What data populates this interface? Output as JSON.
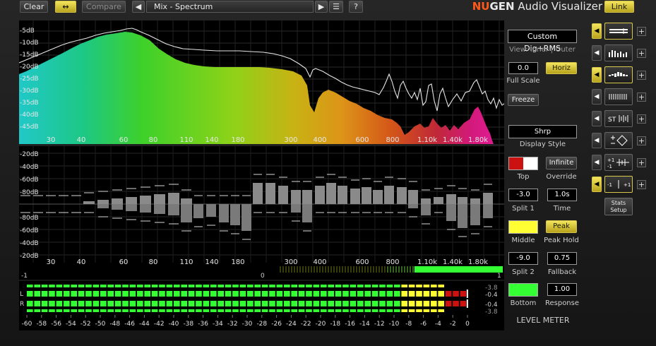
{
  "toolbar": {
    "clear_label": "Clear",
    "swap_glyph": "↔",
    "compare_label": "Compare",
    "preset_name": "Mix - Spectrum",
    "help_label": "?"
  },
  "brand": {
    "prefix": "NU",
    "mid": "GEN",
    "suffix": " Audio Visualizer",
    "link_label": "Link"
  },
  "colors": {
    "accent_yellow": "#e8d83a",
    "top_red": "#cc1111",
    "middle_yellow": "#ffff33",
    "bottom_green": "#33ff33"
  },
  "spectrum": {
    "db_labels": [
      "-5dB",
      "-10dB",
      "-15dB",
      "-20dB",
      "-25dB",
      "-30dB",
      "-35dB",
      "-40dB",
      "-45dB"
    ],
    "freq_labels": [
      "30",
      "40",
      "60",
      "80",
      "110",
      "140",
      "180",
      "300",
      "400",
      "600",
      "800",
      "1.10k",
      "1.40k",
      "1.80k"
    ]
  },
  "stats": {
    "db_labels": [
      "-20dB",
      "-40dB",
      "-60dB",
      "-80dB",
      "-80dB",
      "-60dB",
      "-40dB",
      "-20dB"
    ],
    "freq_labels": [
      "30",
      "40",
      "60",
      "80",
      "110",
      "140",
      "180",
      "300",
      "400",
      "600",
      "800",
      "1.10k",
      "1.40k",
      "1.80k"
    ]
  },
  "correlation": {
    "left_label": "-1",
    "center_label": "0",
    "right_label": "1",
    "value": 0.78
  },
  "level_meter": {
    "title": "LEVEL METER",
    "channel_L": "L",
    "channel_R": "R",
    "peak_values": [
      "-3.8",
      "-0.4",
      "-0.4",
      "-3.8"
    ],
    "scale": [
      "-60",
      "-58",
      "-56",
      "-54",
      "-52",
      "-50",
      "-48",
      "-46",
      "-44",
      "-42",
      "-40",
      "-38",
      "-36",
      "-34",
      "-32",
      "-30",
      "-28",
      "-26",
      "-24",
      "-22",
      "-20",
      "-18",
      "-16",
      "-14",
      "-12",
      "-10",
      "-8",
      "-6",
      "-4",
      "-2",
      "0"
    ],
    "l_level_db": -3.8,
    "r_level_db": -3.8,
    "peak_hold_db": -0.4
  },
  "controls": {
    "display_mode": "Custom Dig+RMS",
    "view_text": "View: Inner | Outer",
    "full_scale_value": "0.0",
    "full_scale_label": "Full Scale",
    "horiz_label": "Horiz",
    "freeze_label": "Freeze",
    "display_style_value": "Shrp",
    "display_style_label": "Display Style",
    "top_label": "Top",
    "override_value": "Infinite",
    "override_label": "Override",
    "split1_value": "-3.0",
    "split1_label": "Split 1",
    "time_value": "1.0s",
    "time_label": "Time",
    "middle_label": "Middle",
    "peak_value": "Peak",
    "peak_hold_label": "Peak Hold",
    "split2_value": "-9.0",
    "split2_label": "Split 2",
    "fallback_value": "0.75",
    "fallback_label": "Fallback",
    "bottom_label": "Bottom",
    "response_value": "1.00",
    "response_label": "Response"
  },
  "vis_buttons": [
    {
      "icon": "level-meter-icon"
    },
    {
      "icon": "spectrum-icon"
    },
    {
      "icon": "stats-icon"
    },
    {
      "icon": "correlation-icon"
    },
    {
      "icon": "stereo-icon",
      "label": "ST"
    },
    {
      "icon": "vectorscope-icon"
    },
    {
      "icon": "phase-icon",
      "label": "+1 -1"
    },
    {
      "icon": "balance-icon",
      "label": "-1 | +1"
    }
  ],
  "stats_setup_label": "Stats Setup"
}
